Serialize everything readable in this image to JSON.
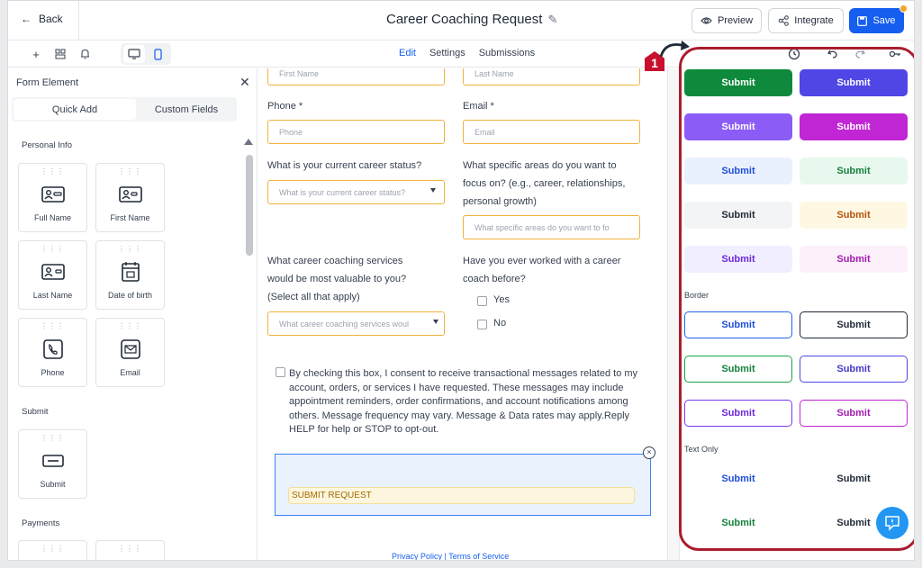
{
  "header": {
    "back_label": "Back",
    "title": "Career Coaching Request",
    "preview_label": "Preview",
    "integrate_label": "Integrate",
    "save_label": "Save"
  },
  "toolbar": {
    "tabs": [
      {
        "label": "Edit",
        "active": true
      },
      {
        "label": "Settings",
        "active": false
      },
      {
        "label": "Submissions",
        "active": false
      }
    ]
  },
  "left_panel": {
    "title": "Form Element",
    "tabs": [
      "Quick Add",
      "Custom Fields"
    ],
    "sections": {
      "personal_info": "Personal Info",
      "submit": "Submit",
      "payments": "Payments"
    },
    "elements": [
      {
        "label": "Full Name",
        "icon": "id-card-icon"
      },
      {
        "label": "First Name",
        "icon": "id-card-icon"
      },
      {
        "label": "Last Name",
        "icon": "id-card-icon"
      },
      {
        "label": "Date of birth",
        "icon": "calendar-icon"
      },
      {
        "label": "Phone",
        "icon": "phone-icon"
      },
      {
        "label": "Email",
        "icon": "envelope-icon"
      },
      {
        "label": "Submit",
        "icon": "button-icon"
      }
    ]
  },
  "form": {
    "first_name_placeholder": "First Name",
    "last_name_placeholder": "Last Name",
    "phone_label": "Phone *",
    "phone_placeholder": "Phone",
    "email_label": "Email *",
    "email_placeholder": "Email",
    "career_status_label": "What is your current career status?",
    "career_status_placeholder": "What is your current career status?",
    "focus_label_1": "What specific areas do you want to",
    "focus_label_2": "focus on? (e.g., career, relationships,",
    "focus_label_3": "personal growth)",
    "focus_placeholder": "What specific areas do you want to fo",
    "services_label_1": "What career coaching services",
    "services_label_2": "would be most valuable to you?",
    "services_label_3": "(Select all that apply)",
    "services_placeholder": "What career coaching services woul",
    "coach_label_1": "Have you ever worked with a career",
    "coach_label_2": "coach before?",
    "options": [
      "Yes",
      "No"
    ],
    "consent_text": "By checking this box, I consent to receive transactional messages related to my account, orders, or services I have requested. These messages may include appointment reminders, order confirmations, and account notifications among others. Message frequency may vary. Message & Data rates may apply.Reply HELP for help or STOP to opt-out.",
    "submit_button": "SUBMIT REQUEST",
    "footer_links": "Privacy Policy | Terms of Service"
  },
  "right_panel": {
    "border_heading": "Border",
    "text_only_heading": "Text Only",
    "button_label": "Submit",
    "marker_number": "1",
    "filled_styles": [
      {
        "bg": "#0f8a3c",
        "fg": "#ffffff"
      },
      {
        "bg": "#4f46e5",
        "fg": "#ffffff"
      },
      {
        "bg": "#8b5cf6",
        "fg": "#ffffff"
      },
      {
        "bg": "#c026d3",
        "fg": "#ffffff"
      },
      {
        "bg": "#eaf1fe",
        "fg": "#1d4ed8"
      },
      {
        "bg": "#e9f8ee",
        "fg": "#15803d"
      },
      {
        "bg": "#f3f4f6",
        "fg": "#1f2937"
      },
      {
        "bg": "#fef8e3",
        "fg": "#b45309"
      },
      {
        "bg": "#f1efff",
        "fg": "#6d28d9"
      },
      {
        "bg": "#fcf0fb",
        "fg": "#a21caf"
      }
    ],
    "border_styles": [
      {
        "border": "#2563eb",
        "fg": "#1d4ed8"
      },
      {
        "border": "#1f2937",
        "fg": "#1f2937"
      },
      {
        "border": "#16a34a",
        "fg": "#15803d"
      },
      {
        "border": "#4f46e5",
        "fg": "#4338ca"
      },
      {
        "border": "#7c3aed",
        "fg": "#6d28d9"
      },
      {
        "border": "#c026d3",
        "fg": "#a21caf"
      }
    ],
    "text_styles": [
      {
        "fg": "#1d4ed8"
      },
      {
        "fg": "#1f2937"
      },
      {
        "fg": "#15803d"
      },
      {
        "fg": "#1f2937"
      }
    ]
  },
  "colors": {
    "accent": "#155eef",
    "highlight_ring": "#ab1d2d",
    "input_border": "#f0b23e"
  }
}
